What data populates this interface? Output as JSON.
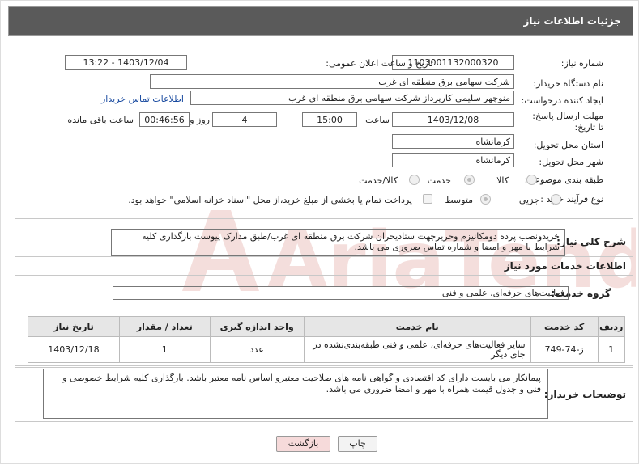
{
  "header": {
    "title": "جزئیات اطلاعات نیاز"
  },
  "fields": {
    "need_number_label": "شماره نیاز:",
    "need_number": "1103001132000320",
    "announce_label": "تاریخ و ساعت اعلان عمومی:",
    "announce_value": "1403/12/04 - 13:22",
    "buyer_org_label": "نام دستگاه خریدار:",
    "buyer_org": "شرکت سهامی برق منطقه ای غرب",
    "requester_label": "ایجاد کننده درخواست:",
    "requester": "منوچهر  سلیمی کارپرداز شرکت سهامی برق منطقه ای غرب",
    "buyer_contact_link": "اطلاعات تماس خریدار",
    "deadline_label": "مهلت ارسال پاسخ: تا تاریخ:",
    "deadline_date": "1403/12/08",
    "time_label": "ساعت",
    "deadline_time": "15:00",
    "days_value": "4",
    "days_label": "روز و",
    "remaining_time": "00:46:56",
    "remaining_label": "ساعت باقی مانده",
    "province_label": "استان محل تحویل:",
    "province": "کرمانشاه",
    "city_label": "شهر محل تحویل:",
    "city": "کرمانشاه",
    "category_label": "طبقه بندی موضوعی:",
    "category_options": [
      "کالا",
      "خدمت",
      "کالا/خدمت"
    ],
    "process_label": "نوع فرآیند خرید :",
    "process_options": [
      "جزیی",
      "متوسط"
    ],
    "payment_note": "پرداخت تمام یا بخشی از مبلغ خرید،از محل \"اسناد خزانه اسلامی\" خواهد بود."
  },
  "summary": {
    "label": "شرح کلی نیاز:",
    "text": "خریدونصب پرده دومکانیزم وحریرجهت ستادیحران شرکت برق منطقه ای غرب/طبق مدارک پیوست بارگذاری کلیه شرایط با مهر و امضا و شماره تماس ضروری می باشد."
  },
  "services": {
    "section_title": "اطلاعات خدمات مورد نیاز",
    "group_label": "گروه خدمت:",
    "group_value": "فعالیت‌های حرفه‌ای، علمی و فنی",
    "columns": [
      "ردیف",
      "کد خدمت",
      "نام خدمت",
      "واحد اندازه گیری",
      "تعداد / مقدار",
      "تاریخ نیاز"
    ],
    "rows": [
      {
        "row": "1",
        "code": "ز-74-749",
        "name": "سایر فعالیت‌های حرفه‌ای، علمی و فنی طبقه‌بندی‌نشده در جای دیگر",
        "unit": "عدد",
        "qty": "1",
        "date": "1403/12/18"
      }
    ]
  },
  "buyer_notes": {
    "label": "توضیحات خریدار:",
    "text": "پیمانکار می بایست دارای کد اقتصادی و گواهی نامه های صلاحیت معتبرو اساس نامه معتبر  باشد. بارگذاری کلیه شرایط خصوصی و فنی و جدول قیمت همراه با مهر و امضا ضروری می باشد."
  },
  "buttons": {
    "print": "چاپ",
    "back": "بازگشت"
  },
  "watermark": {
    "text": "AriaTender.neT"
  },
  "colors": {
    "header_bg": "#5a5a5a",
    "link": "#1a4ba0",
    "back_btn": "#f6dada",
    "watermark": "#c0392b"
  }
}
